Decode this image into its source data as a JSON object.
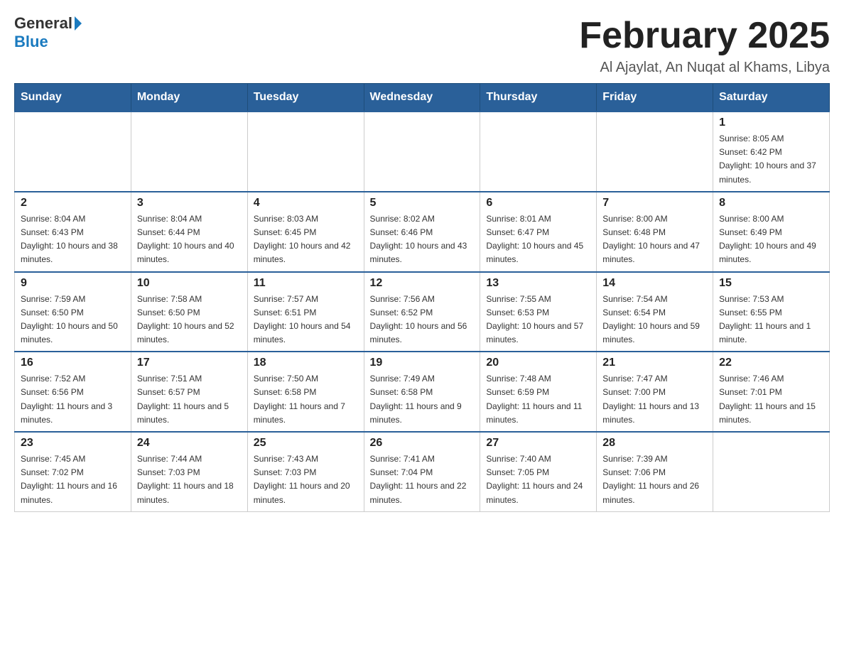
{
  "header": {
    "logo_general": "General",
    "logo_blue": "Blue",
    "title": "February 2025",
    "location": "Al Ajaylat, An Nuqat al Khams, Libya"
  },
  "days_of_week": [
    "Sunday",
    "Monday",
    "Tuesday",
    "Wednesday",
    "Thursday",
    "Friday",
    "Saturday"
  ],
  "weeks": [
    [
      {
        "day": "",
        "sunrise": "",
        "sunset": "",
        "daylight": ""
      },
      {
        "day": "",
        "sunrise": "",
        "sunset": "",
        "daylight": ""
      },
      {
        "day": "",
        "sunrise": "",
        "sunset": "",
        "daylight": ""
      },
      {
        "day": "",
        "sunrise": "",
        "sunset": "",
        "daylight": ""
      },
      {
        "day": "",
        "sunrise": "",
        "sunset": "",
        "daylight": ""
      },
      {
        "day": "",
        "sunrise": "",
        "sunset": "",
        "daylight": ""
      },
      {
        "day": "1",
        "sunrise": "Sunrise: 8:05 AM",
        "sunset": "Sunset: 6:42 PM",
        "daylight": "Daylight: 10 hours and 37 minutes."
      }
    ],
    [
      {
        "day": "2",
        "sunrise": "Sunrise: 8:04 AM",
        "sunset": "Sunset: 6:43 PM",
        "daylight": "Daylight: 10 hours and 38 minutes."
      },
      {
        "day": "3",
        "sunrise": "Sunrise: 8:04 AM",
        "sunset": "Sunset: 6:44 PM",
        "daylight": "Daylight: 10 hours and 40 minutes."
      },
      {
        "day": "4",
        "sunrise": "Sunrise: 8:03 AM",
        "sunset": "Sunset: 6:45 PM",
        "daylight": "Daylight: 10 hours and 42 minutes."
      },
      {
        "day": "5",
        "sunrise": "Sunrise: 8:02 AM",
        "sunset": "Sunset: 6:46 PM",
        "daylight": "Daylight: 10 hours and 43 minutes."
      },
      {
        "day": "6",
        "sunrise": "Sunrise: 8:01 AM",
        "sunset": "Sunset: 6:47 PM",
        "daylight": "Daylight: 10 hours and 45 minutes."
      },
      {
        "day": "7",
        "sunrise": "Sunrise: 8:00 AM",
        "sunset": "Sunset: 6:48 PM",
        "daylight": "Daylight: 10 hours and 47 minutes."
      },
      {
        "day": "8",
        "sunrise": "Sunrise: 8:00 AM",
        "sunset": "Sunset: 6:49 PM",
        "daylight": "Daylight: 10 hours and 49 minutes."
      }
    ],
    [
      {
        "day": "9",
        "sunrise": "Sunrise: 7:59 AM",
        "sunset": "Sunset: 6:50 PM",
        "daylight": "Daylight: 10 hours and 50 minutes."
      },
      {
        "day": "10",
        "sunrise": "Sunrise: 7:58 AM",
        "sunset": "Sunset: 6:50 PM",
        "daylight": "Daylight: 10 hours and 52 minutes."
      },
      {
        "day": "11",
        "sunrise": "Sunrise: 7:57 AM",
        "sunset": "Sunset: 6:51 PM",
        "daylight": "Daylight: 10 hours and 54 minutes."
      },
      {
        "day": "12",
        "sunrise": "Sunrise: 7:56 AM",
        "sunset": "Sunset: 6:52 PM",
        "daylight": "Daylight: 10 hours and 56 minutes."
      },
      {
        "day": "13",
        "sunrise": "Sunrise: 7:55 AM",
        "sunset": "Sunset: 6:53 PM",
        "daylight": "Daylight: 10 hours and 57 minutes."
      },
      {
        "day": "14",
        "sunrise": "Sunrise: 7:54 AM",
        "sunset": "Sunset: 6:54 PM",
        "daylight": "Daylight: 10 hours and 59 minutes."
      },
      {
        "day": "15",
        "sunrise": "Sunrise: 7:53 AM",
        "sunset": "Sunset: 6:55 PM",
        "daylight": "Daylight: 11 hours and 1 minute."
      }
    ],
    [
      {
        "day": "16",
        "sunrise": "Sunrise: 7:52 AM",
        "sunset": "Sunset: 6:56 PM",
        "daylight": "Daylight: 11 hours and 3 minutes."
      },
      {
        "day": "17",
        "sunrise": "Sunrise: 7:51 AM",
        "sunset": "Sunset: 6:57 PM",
        "daylight": "Daylight: 11 hours and 5 minutes."
      },
      {
        "day": "18",
        "sunrise": "Sunrise: 7:50 AM",
        "sunset": "Sunset: 6:58 PM",
        "daylight": "Daylight: 11 hours and 7 minutes."
      },
      {
        "day": "19",
        "sunrise": "Sunrise: 7:49 AM",
        "sunset": "Sunset: 6:58 PM",
        "daylight": "Daylight: 11 hours and 9 minutes."
      },
      {
        "day": "20",
        "sunrise": "Sunrise: 7:48 AM",
        "sunset": "Sunset: 6:59 PM",
        "daylight": "Daylight: 11 hours and 11 minutes."
      },
      {
        "day": "21",
        "sunrise": "Sunrise: 7:47 AM",
        "sunset": "Sunset: 7:00 PM",
        "daylight": "Daylight: 11 hours and 13 minutes."
      },
      {
        "day": "22",
        "sunrise": "Sunrise: 7:46 AM",
        "sunset": "Sunset: 7:01 PM",
        "daylight": "Daylight: 11 hours and 15 minutes."
      }
    ],
    [
      {
        "day": "23",
        "sunrise": "Sunrise: 7:45 AM",
        "sunset": "Sunset: 7:02 PM",
        "daylight": "Daylight: 11 hours and 16 minutes."
      },
      {
        "day": "24",
        "sunrise": "Sunrise: 7:44 AM",
        "sunset": "Sunset: 7:03 PM",
        "daylight": "Daylight: 11 hours and 18 minutes."
      },
      {
        "day": "25",
        "sunrise": "Sunrise: 7:43 AM",
        "sunset": "Sunset: 7:03 PM",
        "daylight": "Daylight: 11 hours and 20 minutes."
      },
      {
        "day": "26",
        "sunrise": "Sunrise: 7:41 AM",
        "sunset": "Sunset: 7:04 PM",
        "daylight": "Daylight: 11 hours and 22 minutes."
      },
      {
        "day": "27",
        "sunrise": "Sunrise: 7:40 AM",
        "sunset": "Sunset: 7:05 PM",
        "daylight": "Daylight: 11 hours and 24 minutes."
      },
      {
        "day": "28",
        "sunrise": "Sunrise: 7:39 AM",
        "sunset": "Sunset: 7:06 PM",
        "daylight": "Daylight: 11 hours and 26 minutes."
      },
      {
        "day": "",
        "sunrise": "",
        "sunset": "",
        "daylight": ""
      }
    ]
  ]
}
